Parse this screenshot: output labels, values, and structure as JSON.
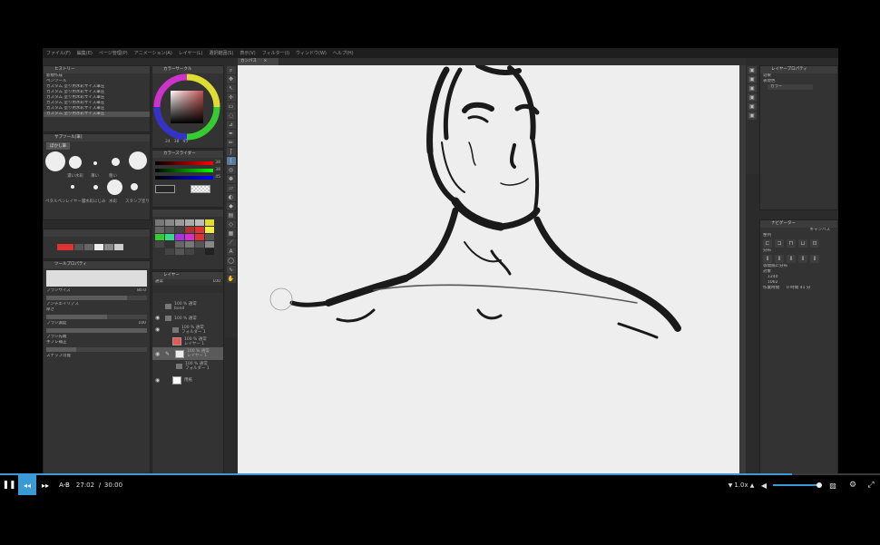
{
  "menu": [
    "ファイル(F)",
    "編集(E)",
    "ページ管理(P)",
    "アニメーション(A)",
    "レイヤー(L)",
    "選択範囲(S)",
    "表示(V)",
    "フィルター(I)",
    "ウィンドウ(W)",
    "ヘルプ(H)"
  ],
  "history": {
    "title": "ヒストリー",
    "items": [
      "新規作成",
      "ペンツール",
      "カスタム 塗り用水彩サイズ筆圧",
      "カスタム 塗り用水彩サイズ筆圧",
      "カスタム 塗り用水彩サイズ筆圧",
      "カスタム 塗り用水彩サイズ筆圧",
      "カスタム 塗り用水彩サイズ筆圧",
      "カスタム 塗り用水彩サイズ筆圧"
    ]
  },
  "subtool": {
    "title": "サブツール[筆]",
    "tab": "ぼかし筆",
    "brushes": [
      "",
      "濃い水彩",
      "薄い",
      "水彩",
      "粗い",
      "水彩境界",
      "ペタルペン",
      "レイヤー層",
      "水彩にじみ",
      "水彩",
      "スタンプ塗り"
    ]
  },
  "brush_panel": {
    "title": "ツールプロパティ",
    "brush_size_label": "ブラシサイズ",
    "brush_size_value": "80.0",
    "antialias_label": "アンチエイリアス",
    "thickness_label": "厚さ",
    "density_label": "ブラシ濃度",
    "density_value": "100",
    "tip_label": "ブラシ先端",
    "stabilize_label": "手ブレ補正",
    "snap_label": "スナップ可能"
  },
  "color_wheel": {
    "title": "カラーサークル",
    "h": "24",
    "s": "38",
    "v": "45"
  },
  "color_slider": {
    "title": "カラースライダー",
    "r": "38",
    "g": "38",
    "b": "45"
  },
  "layers": {
    "title": "レイヤー",
    "blend": "通常",
    "opacity": "100",
    "items": [
      {
        "name": "100 % 通常",
        "sub": "bond"
      },
      {
        "name": "100 % 通常",
        "sub": ""
      },
      {
        "name": "100 % 通常",
        "sub": "フォルダー 1"
      },
      {
        "name": "100 % 通常",
        "sub": "レイヤー 1"
      },
      {
        "name": "100 % 通常",
        "sub": "レイヤー 1"
      },
      {
        "name": "100 % 通常",
        "sub": "フォルダー 1"
      },
      {
        "name": "用紙",
        "sub": ""
      }
    ]
  },
  "canvas_tab": "カンバス",
  "right_panel": {
    "title": "レイヤープロパティ",
    "effect_label": "効果",
    "expression_label": "表現色",
    "expression_value": "カラー"
  },
  "canvas_info": {
    "title": "ナビゲーター",
    "canvas_label": "キャンバス",
    "snap_label": "整列",
    "distribute_label": "分布",
    "equal_space_label": "等間隔に分布",
    "target_label": "対象",
    "width_label": "1240",
    "height_label": "1062",
    "history_time_label": "作業時間",
    "history_time_value": "0 時間 41 分"
  },
  "player": {
    "ab": "A-B",
    "current": "27:02",
    "separator": "/",
    "total": "30:00",
    "speed": "1.0x",
    "progress_fraction": 0.9
  }
}
